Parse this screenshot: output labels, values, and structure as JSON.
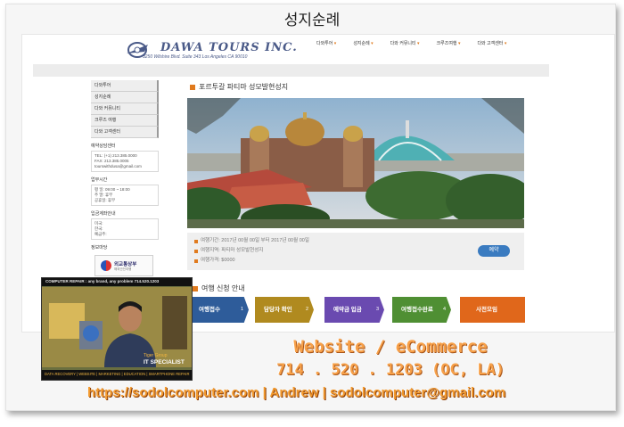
{
  "page_title": "성지순례",
  "logo": {
    "name": "DAWA TOURS INC.",
    "address": "3250 Wilshire Blvd. Suite 343 Los Angeles CA 90010"
  },
  "topnav": [
    "다와투어",
    "성지순례",
    "다와 커뮤니티",
    "크루즈여행",
    "다와 고객센터"
  ],
  "sidebar": {
    "items": [
      "다와투어",
      "성지순례",
      "다와 커뮤니티",
      "크루즈 여행",
      "다와 고객센터"
    ],
    "contact_title": "예약상담센터",
    "contact_lines": [
      "TEL: (+1) 213.385.0000",
      "FAX: 213.385.0005",
      "tourswithdusa@gmail.com"
    ],
    "hours_title": "업무시간",
    "hours_lines": [
      "평 일: 09:00 ~ 18:00",
      "주 말: 휴무",
      "공휴일: 휴무"
    ],
    "account_title": "입금계좌안내",
    "account_lines": [
      "미국:",
      "한국:",
      "예금주:"
    ],
    "info_title": "정보마당",
    "badge_title": "외교통상부",
    "badge_sub": "해외안전여행"
  },
  "content": {
    "heading": "포르투갈 파티마 성모발현성지",
    "info_rows": [
      "여행기간: 2017년 00월 00일 부터 2017년 00월 00일",
      "여행지역: 파티마 성모발현성지",
      "여행가격: $0000"
    ],
    "reserve_label": "예약",
    "guide_heading": "여행 신청 안내",
    "steps": [
      {
        "label": "여행접수",
        "num": "1",
        "color": "#2e5c9a"
      },
      {
        "label": "담당자 확인",
        "num": "2",
        "color": "#b08a1f"
      },
      {
        "label": "예약금 입금",
        "num": "3",
        "color": "#6a4ab0"
      },
      {
        "label": "여행접수완료",
        "num": "4",
        "color": "#4f8f33"
      },
      {
        "label": "사전모임",
        "num": "",
        "color": "#e0671b"
      }
    ]
  },
  "business_card": {
    "top_line": "COMPUTER REPAIR : any brand, any problem  714.520.1203",
    "brand": "Tiger Group",
    "role": "IT SPECIALIST",
    "bottom_line": "DATA RECOVERY | WEBSITE | MARKETING | EDUCATION | SMARTPHONE REPAIR"
  },
  "promo": {
    "line1": "Website / eCommerce",
    "line2": "714 . 520 . 1203 (OC, LA)",
    "line3": "https://sodolcomputer.com | Andrew | sodolcomputer@gmail.com"
  }
}
